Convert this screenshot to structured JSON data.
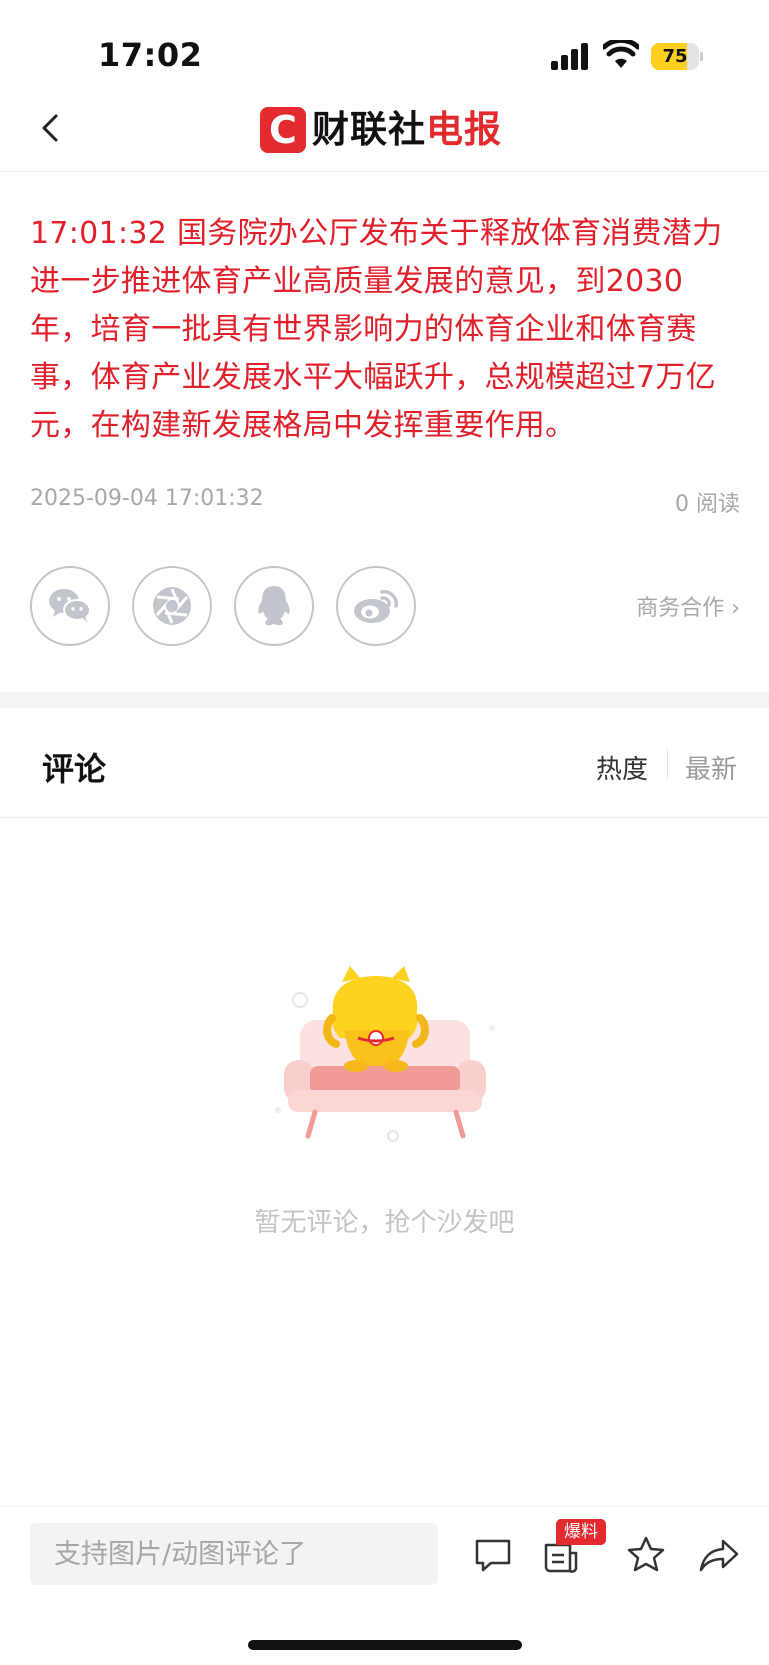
{
  "status_bar": {
    "time": "17:02",
    "battery": "75",
    "battery_level_percent": 75,
    "battery_color": "#ffcf1f"
  },
  "header": {
    "back_icon": "chevron-left-icon",
    "logo_mark": "C",
    "logo_text_black": "财联社",
    "logo_text_red": "电报",
    "brand_color": "#e32a2e"
  },
  "article": {
    "text": "17:01:32  国务院办公厅发布关于释放体育消费潜力进一步推进体育产业高质量发展的意见，到2030年，培育一批具有世界影响力的体育企业和体育赛事，体育产业发展水平大幅跃升，总规模超过7万亿元，在构建新发展格局中发挥重要作用。",
    "color": "#e0202a",
    "date": "2025-09-04 17:01:32",
    "reads": "0 阅读"
  },
  "share": {
    "buttons": [
      {
        "icon": "wechat-icon"
      },
      {
        "icon": "moments-icon"
      },
      {
        "icon": "qq-icon"
      },
      {
        "icon": "weibo-icon"
      }
    ],
    "business_link": "商务合作 ›"
  },
  "comments": {
    "title": "评论",
    "sort_hot": "热度",
    "sort_new": "最新",
    "empty_text": "暂无评论，抢个沙发吧"
  },
  "bottom_bar": {
    "input_placeholder": "支持图片/动图评论了",
    "badge": "爆料",
    "icons": [
      "comment-icon",
      "tipoff-icon",
      "star-icon",
      "share-icon"
    ]
  }
}
